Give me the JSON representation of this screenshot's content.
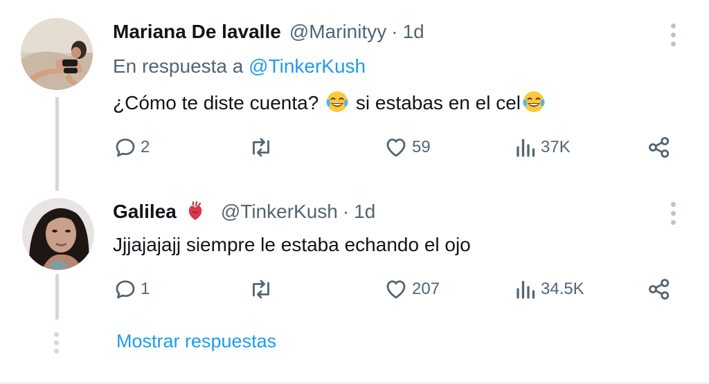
{
  "tweets": [
    {
      "name": "Mariana De lavalle",
      "handle": "@Marinityy",
      "separator": "·",
      "time": "1d",
      "reply_prefix": "En respuesta a",
      "reply_mention": "@TinkerKush",
      "text_part1": "¿Cómo te diste cuenta?",
      "text_part2": "si estabas en el cel",
      "emoji": "face-with-tears-of-joy",
      "actions": {
        "replies": "2",
        "reposts": "",
        "likes": "59",
        "views": "37K"
      }
    },
    {
      "name": "Galilea",
      "name_emoji": "anatomical-heart",
      "handle": "@TinkerKush",
      "separator": "·",
      "time": "1d",
      "text": "Jjjajajajj siempre le estaba echando el ojo",
      "actions": {
        "replies": "1",
        "reposts": "",
        "likes": "207",
        "views": "34.5K"
      }
    }
  ],
  "show_replies_label": "Mostrar respuestas",
  "colors": {
    "accent": "#1d9bf0",
    "text": "#0f1419",
    "secondary": "#536471",
    "thread_line": "#cfd9de"
  }
}
